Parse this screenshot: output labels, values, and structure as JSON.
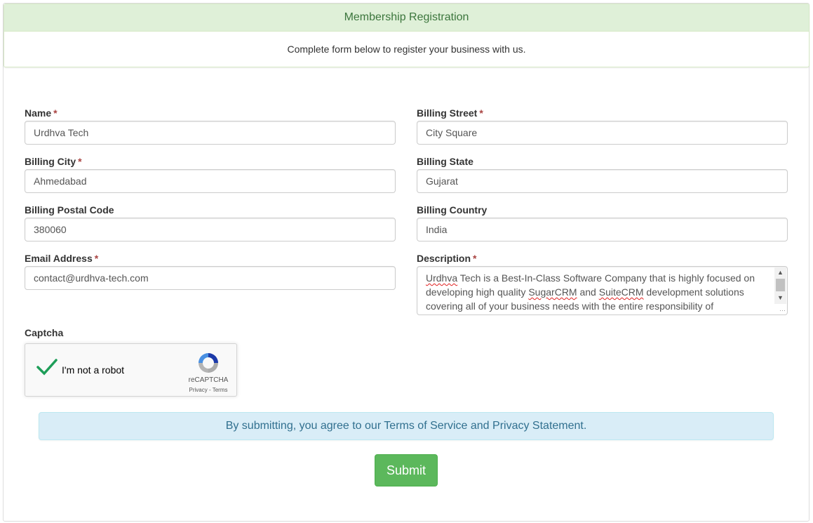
{
  "panel": {
    "title": "Membership Registration",
    "subtitle": "Complete form below to register your business with us."
  },
  "form": {
    "name": {
      "label": "Name",
      "required": "*",
      "value": "Urdhva Tech"
    },
    "billing_street": {
      "label": "Billing Street",
      "required": "*",
      "value": "City Square"
    },
    "billing_city": {
      "label": "Billing City",
      "required": "*",
      "value": "Ahmedabad"
    },
    "billing_state": {
      "label": "Billing State",
      "value": "Gujarat"
    },
    "billing_postal_code": {
      "label": "Billing Postal Code",
      "value": "380060"
    },
    "billing_country": {
      "label": "Billing Country",
      "value": "India"
    },
    "email": {
      "label": "Email Address",
      "required": "*",
      "value": "contact@urdhva-tech.com"
    },
    "description": {
      "label": "Description",
      "required": "*",
      "value_parts": {
        "w1": "Urdhva",
        "t1": " Tech is a Best-In-Class Software Company that is highly focused on developing high quality ",
        "w2": "SugarCRM",
        "t2": " and ",
        "w3": "SuiteCRM",
        "t3": " development solutions covering all of your business needs with the entire responsibility of"
      }
    },
    "captcha": {
      "label": "Captcha",
      "checkbox_label": "I'm not a robot",
      "brand": "reCAPTCHA",
      "privacy": "Privacy",
      "separator": " - ",
      "terms": "Terms",
      "checked": true
    }
  },
  "notice": "By submitting, you agree to our Terms of Service and Privacy Statement.",
  "submit_label": "Submit",
  "colors": {
    "panel_heading_bg": "#dff0d8",
    "panel_heading_text": "#3c763d",
    "alert_bg": "#d9edf7",
    "alert_text": "#31708f",
    "submit_bg": "#5cb85c",
    "required": "#a94442",
    "check": "#1e9e59"
  }
}
